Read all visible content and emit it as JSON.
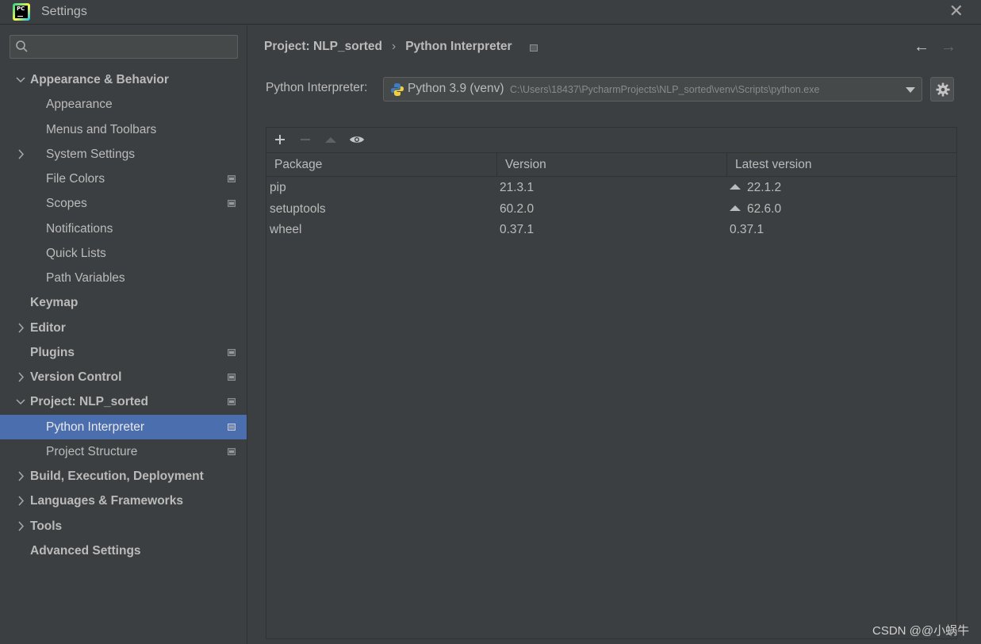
{
  "window": {
    "title": "Settings"
  },
  "sidebar": {
    "search": {
      "placeholder": ""
    },
    "items": [
      {
        "label": "Appearance & Behavior",
        "bold": true,
        "expander": "down",
        "has_project_icon": false
      },
      {
        "label": "Appearance",
        "bold": false,
        "expander": "none",
        "has_project_icon": false
      },
      {
        "label": "Menus and Toolbars",
        "bold": false,
        "expander": "none",
        "has_project_icon": false
      },
      {
        "label": "System Settings",
        "bold": false,
        "expander": "right",
        "has_project_icon": false
      },
      {
        "label": "File Colors",
        "bold": false,
        "expander": "none",
        "has_project_icon": true
      },
      {
        "label": "Scopes",
        "bold": false,
        "expander": "none",
        "has_project_icon": true
      },
      {
        "label": "Notifications",
        "bold": false,
        "expander": "none",
        "has_project_icon": false
      },
      {
        "label": "Quick Lists",
        "bold": false,
        "expander": "none",
        "has_project_icon": false
      },
      {
        "label": "Path Variables",
        "bold": false,
        "expander": "none",
        "has_project_icon": false
      },
      {
        "label": "Keymap",
        "bold": true,
        "expander": "none",
        "has_project_icon": false
      },
      {
        "label": "Editor",
        "bold": true,
        "expander": "right",
        "has_project_icon": false
      },
      {
        "label": "Plugins",
        "bold": true,
        "expander": "none",
        "has_project_icon": true
      },
      {
        "label": "Version Control",
        "bold": true,
        "expander": "right",
        "has_project_icon": true
      },
      {
        "label": "Project: NLP_sorted",
        "bold": true,
        "expander": "down",
        "has_project_icon": true
      },
      {
        "label": "Python Interpreter",
        "bold": false,
        "expander": "none",
        "has_project_icon": true,
        "selected": true
      },
      {
        "label": "Project Structure",
        "bold": false,
        "expander": "none",
        "has_project_icon": true
      },
      {
        "label": "Build, Execution, Deployment",
        "bold": true,
        "expander": "right",
        "has_project_icon": false
      },
      {
        "label": "Languages & Frameworks",
        "bold": true,
        "expander": "right",
        "has_project_icon": false
      },
      {
        "label": "Tools",
        "bold": true,
        "expander": "right",
        "has_project_icon": false
      },
      {
        "label": "Advanced Settings",
        "bold": true,
        "expander": "none",
        "has_project_icon": false
      }
    ]
  },
  "breadcrumb": {
    "parent": "Project: NLP_sorted",
    "separator": "›",
    "current": "Python Interpreter"
  },
  "interpreter": {
    "label": "Python Interpreter:",
    "name": "Python 3.9 (venv)",
    "path": "C:\\Users\\18437\\PycharmProjects\\NLP_sorted\\venv\\Scripts\\python.exe"
  },
  "toolbar": {
    "add": "+",
    "remove": "−",
    "upgrade": "▲",
    "show": "eye"
  },
  "packages": {
    "columns": [
      "Package",
      "Version",
      "Latest version"
    ],
    "rows": [
      {
        "package": "pip",
        "version": "21.3.1",
        "latest": "22.1.2",
        "upgradable": true
      },
      {
        "package": "setuptools",
        "version": "60.2.0",
        "latest": "62.6.0",
        "upgradable": true
      },
      {
        "package": "wheel",
        "version": "0.37.1",
        "latest": "0.37.1",
        "upgradable": false
      }
    ]
  },
  "watermark": "CSDN @@小蜗牛",
  "colors": {
    "background": "#3c3f41",
    "selection": "#4b6eaf",
    "text": "#bbbbbb"
  }
}
